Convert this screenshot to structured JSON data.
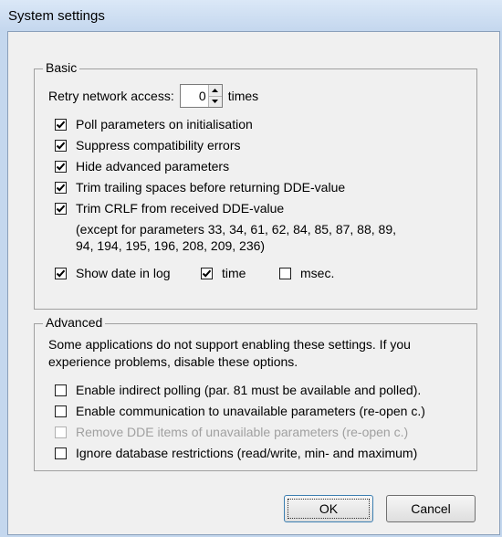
{
  "window": {
    "title": "System settings"
  },
  "basic": {
    "legend": "Basic",
    "retry_label_before": "Retry network access:",
    "retry_value": "0",
    "retry_label_after": "times",
    "options": [
      {
        "label": "Poll parameters on initialisation",
        "checked": true
      },
      {
        "label": "Suppress compatibility errors",
        "checked": true
      },
      {
        "label": "Hide advanced parameters",
        "checked": true
      },
      {
        "label": "Trim trailing spaces before returning DDE-value",
        "checked": true
      },
      {
        "label": "Trim CRLF from received DDE-value",
        "checked": true
      }
    ],
    "crlf_note_line1": "(except for parameters 33, 34, 61, 62, 84, 85, 87, 88, 89,",
    "crlf_note_line2": "94, 194, 195, 196, 208, 209, 236)",
    "show_date": {
      "label": "Show date in log",
      "checked": true
    },
    "show_time": {
      "label": "time",
      "checked": true
    },
    "show_msec": {
      "label": "msec.",
      "checked": false
    }
  },
  "advanced": {
    "legend": "Advanced",
    "description_line1": "Some applications do not support enabling these settings. If you",
    "description_line2": "experience problems, disable these options.",
    "options": [
      {
        "label": "Enable indirect polling (par. 81 must be available and polled).",
        "checked": false,
        "disabled": false
      },
      {
        "label": "Enable communication to unavailable parameters (re-open c.)",
        "checked": false,
        "disabled": false
      },
      {
        "label": "Remove DDE items of unavailable parameters (re-open c.)",
        "checked": false,
        "disabled": true
      },
      {
        "label": "Ignore database restrictions (read/write, min- and maximum)",
        "checked": false,
        "disabled": false
      }
    ]
  },
  "buttons": {
    "ok": "OK",
    "cancel": "Cancel"
  }
}
